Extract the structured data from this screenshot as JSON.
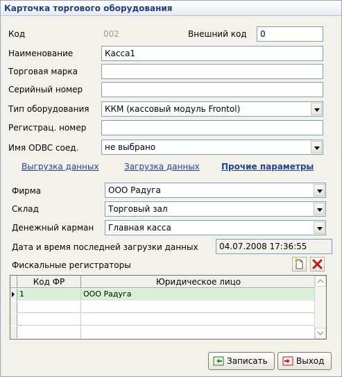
{
  "window": {
    "title": "Карточка торгового оборудования"
  },
  "fields": {
    "code_label": "Код",
    "code_value": "002",
    "ext_code_label": "Внешний код",
    "ext_code_value": "0",
    "name_label": "Наименование",
    "name_value": "Касса1",
    "brand_label": "Торговая марка",
    "brand_value": "",
    "serial_label": "Серийный номер",
    "serial_value": "",
    "type_label": "Тип оборудования",
    "type_value": "ККМ (кассовый модуль Frontol)",
    "regnum_label": "Регистрац. номер",
    "regnum_value": "",
    "odbc_label": "Имя ODBC соед.",
    "odbc_value": "не выбрано"
  },
  "links": {
    "export": "Выгрузка данных",
    "import": "Загрузка данных",
    "other": "Прочие параметры"
  },
  "org": {
    "firm_label": "Фирма",
    "firm_value": "ООО Радуга",
    "store_label": "Склад",
    "store_value": "Торговый зал",
    "pocket_label": "Денежный карман",
    "pocket_value": "Главная касса",
    "lastload_label": "Дата и время последней загрузки данных",
    "lastload_value": "04.07.2008 17:36:55"
  },
  "fiscal": {
    "title": "Фискальные регистраторы",
    "columns": [
      "Код ФР",
      "Юридическое лицо"
    ],
    "rows": [
      {
        "code": "1",
        "entity": "ООО Радуга"
      }
    ]
  },
  "buttons": {
    "save": "Записать",
    "exit": "Выход"
  },
  "colors": {
    "title_text": "#1d3f8a",
    "link": "#1f3fa6",
    "selected_row": "#d8efd8",
    "delete_red": "#d01010"
  }
}
